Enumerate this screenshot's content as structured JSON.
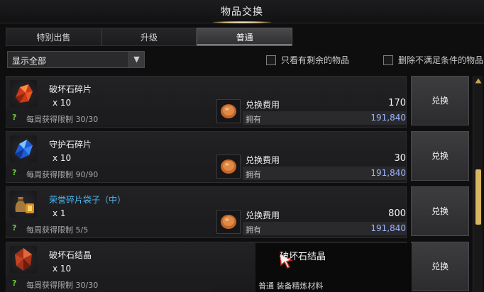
{
  "window": {
    "title": "物品交换"
  },
  "tabs": [
    {
      "label": "特别出售",
      "active": false
    },
    {
      "label": "升级",
      "active": false
    },
    {
      "label": "普通",
      "active": true
    }
  ],
  "filters": {
    "dropdown_value": "显示全部",
    "checkbox_remaining_label": "只看有剩余的物品",
    "checkbox_remaining_checked": false,
    "checkbox_hide_unmet_label": "删除不满足条件的物品",
    "checkbox_hide_unmet_checked": false
  },
  "items": [
    {
      "name": "破坏石碎片",
      "name_color": "white",
      "icon": "red-crystal-fragment-icon",
      "qty": "x 10",
      "limit_label": "每周获得限制 30/30",
      "cost_label": "兑换费用",
      "cost": "170",
      "own_label": "拥有",
      "owned": "191,840",
      "button": "兑换"
    },
    {
      "name": "守护石碎片",
      "name_color": "white",
      "icon": "blue-crystal-fragment-icon",
      "qty": "x 10",
      "limit_label": "每周获得限制 90/90",
      "cost_label": "兑换费用",
      "cost": "30",
      "own_label": "拥有",
      "owned": "191,840",
      "button": "兑换"
    },
    {
      "name": "荣誉碎片袋子（中）",
      "name_color": "blue",
      "icon": "honor-shard-pouch-icon",
      "qty": "x 1",
      "limit_label": "每周获得限制 5/5",
      "cost_label": "兑换费用",
      "cost": "800",
      "own_label": "拥有",
      "owned": "191,840",
      "button": "兑换"
    },
    {
      "name": "破坏石结晶",
      "name_color": "white",
      "icon": "red-crystal-icon",
      "qty": "x 10",
      "limit_label": "每周获得限制 30/30",
      "cost_label": "",
      "cost": "",
      "own_label": "",
      "owned": "",
      "button": "兑换"
    }
  ],
  "tooltip": {
    "title": "破坏石结晶",
    "subtitle": "普通 装备精炼材料"
  },
  "colors": {
    "accent_gold": "#d8b562",
    "owned_blue": "#9fb3ff",
    "rare_name_blue": "#4fb6ee",
    "limit_check_green": "#6fcb3e"
  }
}
